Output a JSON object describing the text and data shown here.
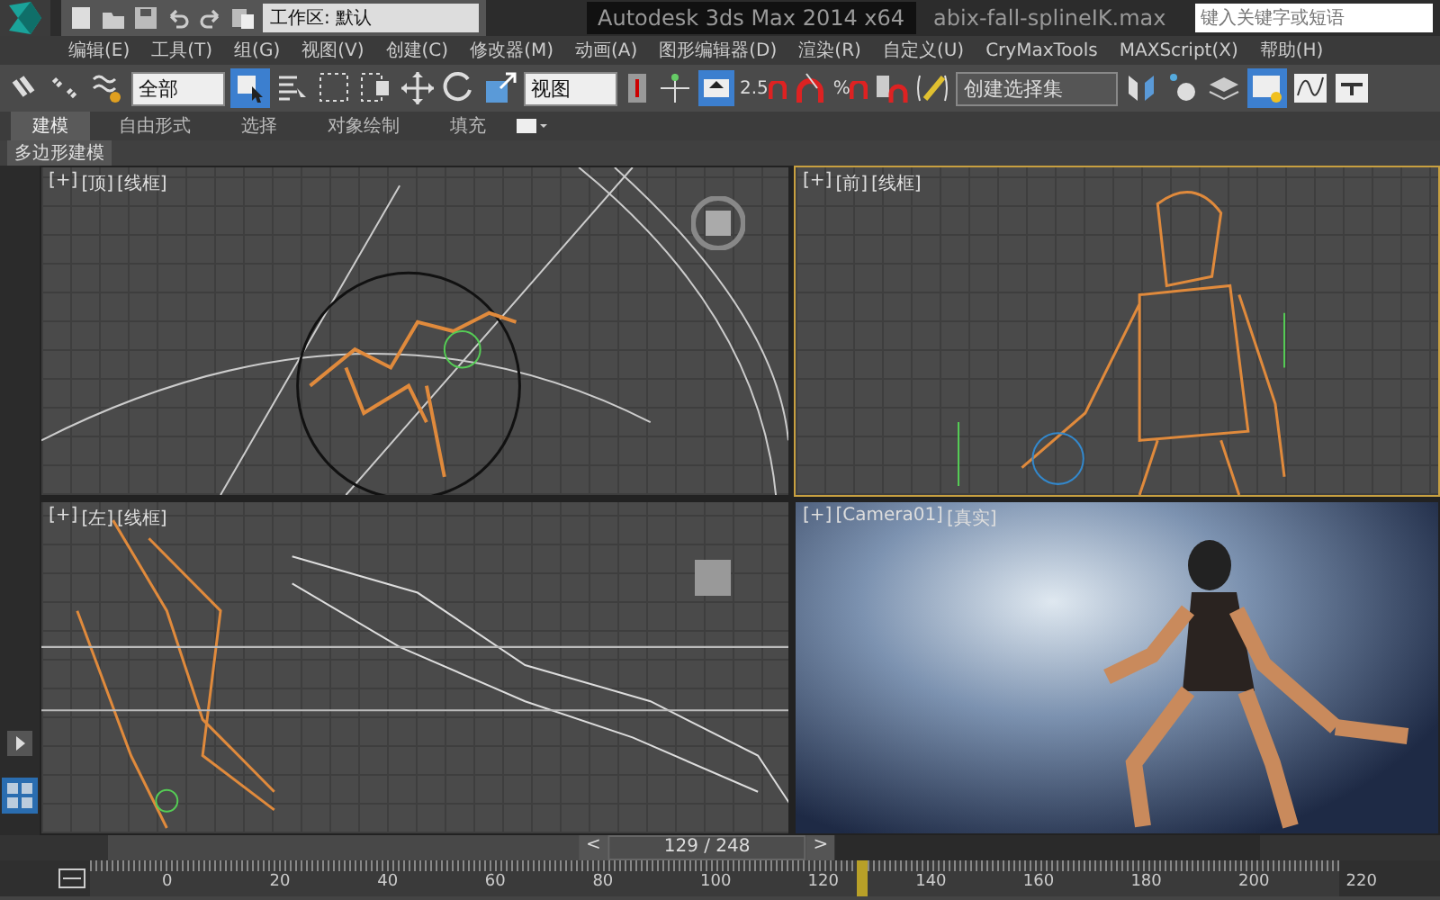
{
  "title_bar": {
    "workspace": "工作区: 默认",
    "app_title": "Autodesk 3ds Max  2014 x64",
    "file_name": "abix-fall-splineIK.max",
    "search": {
      "placeholder": "键入关键字或短语"
    }
  },
  "menu_bar": [
    "编辑(E)",
    "工具(T)",
    "组(G)",
    "视图(V)",
    "创建(C)",
    "修改器(M)",
    "动画(A)",
    "图形编辑器(D)",
    "渲染(R)",
    "自定义(U)",
    "CryMaxTools",
    "MAXScript(X)",
    "帮助(H)"
  ],
  "toolbar": {
    "selection_filter": "全部",
    "select_object": {
      "selected": true
    },
    "coordinate_system": "视图",
    "manipulate": {
      "selected": true
    },
    "angle_snap_value": "2.5",
    "percent_snap": "%",
    "named_selection": "创建选择集",
    "scene_explorer": {
      "selected": true
    }
  },
  "ribbon": {
    "tabs": [
      {
        "label": "建模",
        "selected": true
      },
      {
        "label": "自由形式",
        "selected": false
      },
      {
        "label": "选择",
        "selected": false
      },
      {
        "label": "对象绘制",
        "selected": false
      },
      {
        "label": "填充",
        "selected": false
      }
    ],
    "panel_label": "多边形建模"
  },
  "viewports": [
    {
      "labels": [
        "[+]",
        "[顶]",
        "[线框]"
      ],
      "kind": "top",
      "active": false
    },
    {
      "labels": [
        "[+]",
        "[前]",
        "[线框]"
      ],
      "kind": "front",
      "active": true
    },
    {
      "labels": [
        "[+]",
        "[左]",
        "[线框]"
      ],
      "kind": "left",
      "active": false
    },
    {
      "labels": [
        "[+]",
        "[Camera01]",
        "[真实]"
      ],
      "kind": "camera",
      "active": false
    }
  ],
  "time_slider": {
    "prev": "<",
    "frame": "129 / 248",
    "next": ">",
    "level": 0.52
  },
  "track_bar": {
    "ticks": [
      "0",
      "20",
      "40",
      "60",
      "80",
      "100",
      "120",
      "140",
      "160",
      "180",
      "200",
      "220"
    ]
  }
}
